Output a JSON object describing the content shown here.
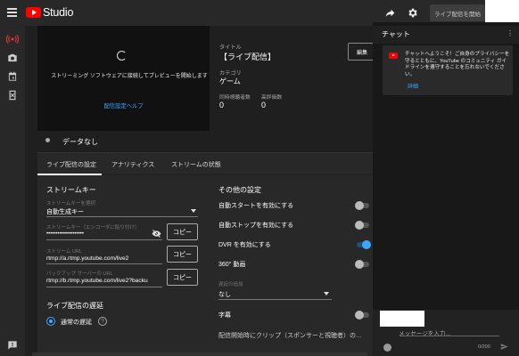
{
  "topbar": {
    "logo_text": "Studio",
    "go_live_label": "ライブ配信を開始"
  },
  "preview": {
    "message": "ストリーミング ソフトウェアに接続してプレビューを開始します",
    "help_link": "配信設定ヘルプ"
  },
  "stream_info": {
    "title_label": "タイトル",
    "title_value": "【ライブ配信】",
    "category_label": "カテゴリ",
    "category_value": "ゲーム",
    "viewers_label": "同時視聴者数",
    "viewers_value": "0",
    "likes_label": "高評価数",
    "likes_value": "0",
    "edit_label": "編集"
  },
  "status": {
    "no_data": "データなし"
  },
  "tabs": [
    "ライブ配信の設定",
    "アナリティクス",
    "ストリームの状態"
  ],
  "stream_key": {
    "section_title": "ストリームキー",
    "select_label": "ストリームキーを選択",
    "select_value": "自動生成キー",
    "key_label": "ストリームキー（エンコーダに貼り付け）",
    "key_value": "••••••••••••••••••••",
    "url_label": "ストリーム URL",
    "url_value": "rtmp://a.rtmp.youtube.com/live2",
    "backup_label": "バックアップ サーバーの URL",
    "backup_value": "rtmp://b.rtmp.youtube.com/live2?backu",
    "copy_label": "コピー"
  },
  "latency": {
    "section_title": "ライブ配信の遅延",
    "option": "通常の遅延"
  },
  "other_settings": {
    "section_title": "その他の設定",
    "toggles": [
      {
        "label": "自動スタートを有効にする",
        "on": false
      },
      {
        "label": "自動ストップを有効にする",
        "on": false
      },
      {
        "label": "DVR を有効にする",
        "on": true
      },
      {
        "label": "360° 動画",
        "on": false
      }
    ],
    "delay_label": "遅延の追加",
    "delay_value": "なし",
    "captions_label": "字幕",
    "cut_label": "配信開始時にクリップ（スポンサーと視聴者）の…"
  },
  "chat": {
    "title": "チャット",
    "welcome": "チャットへようこそ！ご自身のプライバシーを守るとともに、YouTube のコミュニティ ガイドラインを遵守することを忘れないでください。",
    "more_link": "詳細",
    "input_placeholder": "メッセージを入力...",
    "counter": "0/200"
  },
  "colors": {
    "accent": "#3ea6ff",
    "brand": "#ff0000"
  }
}
